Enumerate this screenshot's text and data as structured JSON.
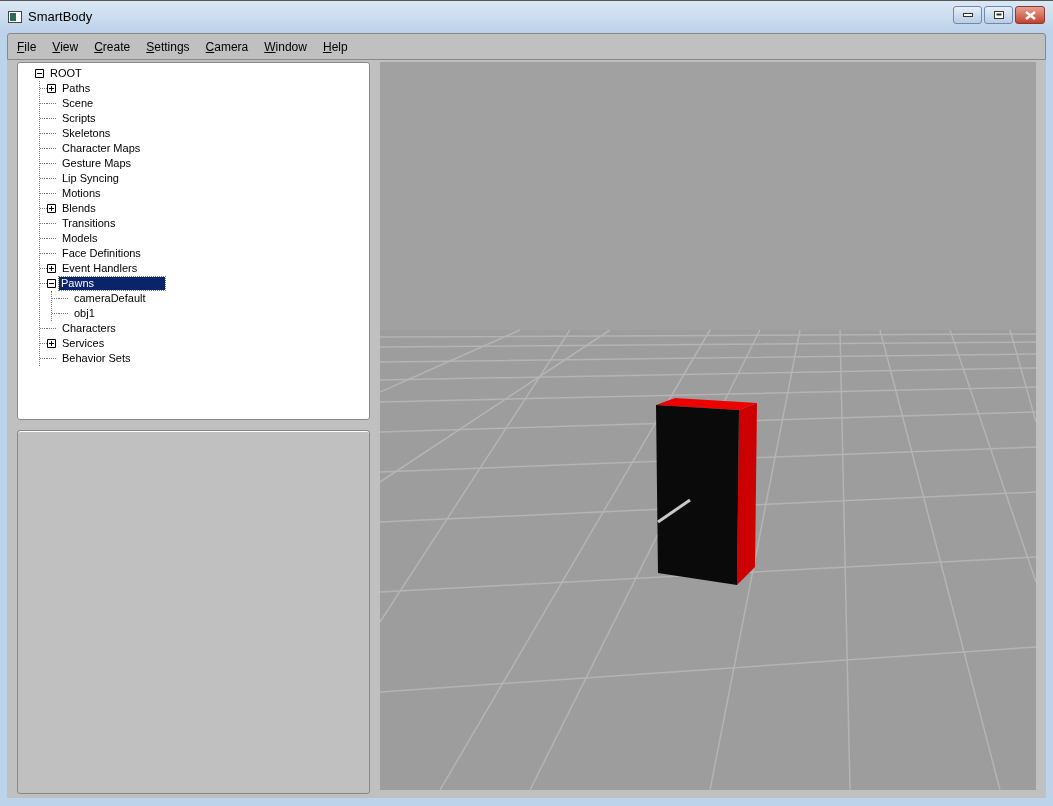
{
  "window": {
    "title": "SmartBody"
  },
  "menu": [
    "File",
    "View",
    "Create",
    "Settings",
    "Camera",
    "Window",
    "Help"
  ],
  "tree": {
    "label": "ROOT",
    "expanded": true,
    "selected": false,
    "children": [
      {
        "label": "Paths",
        "expanded": false,
        "selected": false,
        "has_children": true
      },
      {
        "label": "Scene",
        "selected": false
      },
      {
        "label": "Scripts",
        "selected": false
      },
      {
        "label": "Skeletons",
        "selected": false
      },
      {
        "label": "Character Maps",
        "selected": false
      },
      {
        "label": "Gesture Maps",
        "selected": false
      },
      {
        "label": "Lip Syncing",
        "selected": false
      },
      {
        "label": "Motions",
        "selected": false
      },
      {
        "label": "Blends",
        "expanded": false,
        "selected": false,
        "has_children": true
      },
      {
        "label": "Transitions",
        "selected": false
      },
      {
        "label": "Models",
        "selected": false
      },
      {
        "label": "Face Definitions",
        "selected": false
      },
      {
        "label": "Event Handlers",
        "expanded": false,
        "selected": false,
        "has_children": true
      },
      {
        "label": "Pawns",
        "expanded": true,
        "selected": true,
        "has_children": true,
        "children": [
          {
            "label": "cameraDefault",
            "selected": false
          },
          {
            "label": "obj1",
            "selected": false
          }
        ]
      },
      {
        "label": "Characters",
        "selected": false
      },
      {
        "label": "Services",
        "expanded": false,
        "selected": false,
        "has_children": true
      },
      {
        "label": "Behavior Sets",
        "selected": false
      }
    ]
  }
}
